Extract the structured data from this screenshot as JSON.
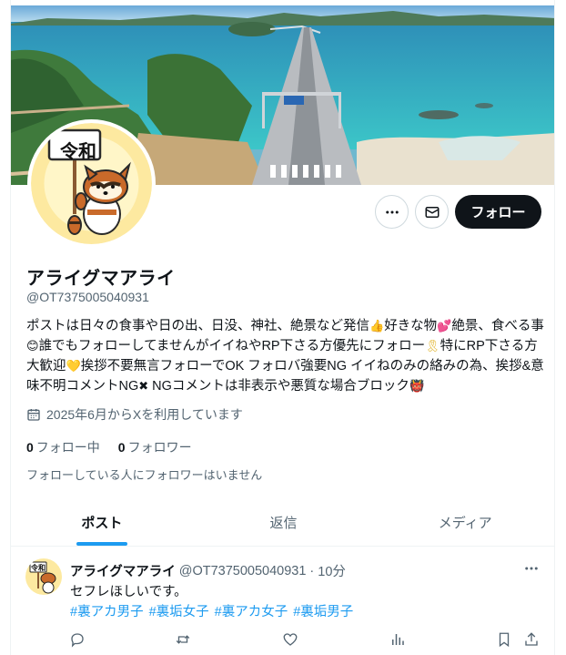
{
  "profile": {
    "name": "アライグマアライ",
    "handle": "@OT7375005040931",
    "bio_parts": [
      "ポストは日々の食事や日の出、日没、神社、絶景など発信",
      "👍",
      "好きな物",
      "💕",
      "絶景、食べる事",
      "😊",
      "誰でもフォローしてませんがイイねやRP下さる方優先にフォロー",
      "🎗",
      "特にRP下さる方大歓迎",
      "💛",
      "挨拶不要無言フォローでOK フォロバ強要NG  イイねのみの絡みの為、挨拶&意味不明コメントNG",
      "✖",
      " NGコメントは非表示や悪質な場合ブロック",
      "👹"
    ],
    "joined": "2025年6月からXを利用しています",
    "following_count": "0",
    "following_label": "フォロー中",
    "followers_count": "0",
    "followers_label": "フォロワー",
    "no_followers_note": "フォローしている人にフォロワーはいません",
    "avatar_sign_text": "令和"
  },
  "actions": {
    "follow_label": "フォロー",
    "more_icon": "more-horizontal-icon",
    "message_icon": "envelope-icon"
  },
  "tabs": [
    {
      "label": "ポスト",
      "active": true
    },
    {
      "label": "返信",
      "active": false
    },
    {
      "label": "メディア",
      "active": false
    }
  ],
  "post": {
    "name": "アライグマアライ",
    "handle": "@OT7375005040931",
    "separator": "·",
    "time": "10分",
    "text": "セフレほしいです。",
    "hashtags": [
      "#裏アカ男子",
      "#裏垢女子",
      "#裏アカ女子",
      "#裏垢男子"
    ],
    "action_icons": [
      "reply-icon",
      "repost-icon",
      "like-icon",
      "views-icon",
      "bookmark-icon",
      "share-icon"
    ]
  },
  "colors": {
    "accent": "#1d9bf0",
    "text_primary": "#0f1419",
    "text_secondary": "#536471",
    "follow_button_bg": "#0f1419"
  }
}
